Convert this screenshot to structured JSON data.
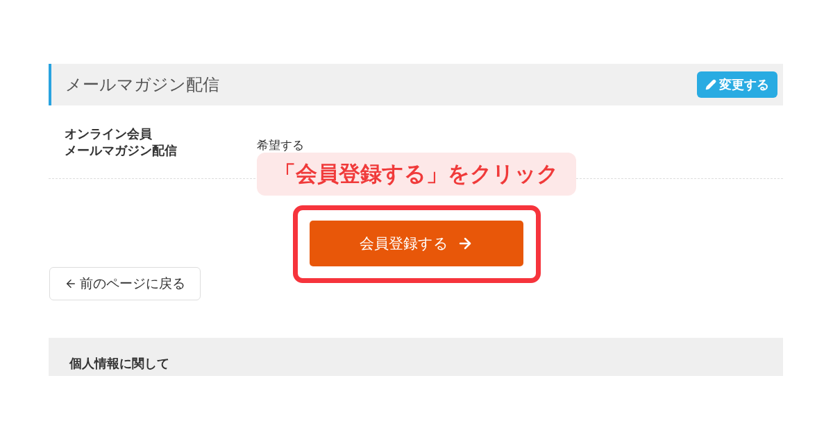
{
  "section": {
    "title": "メールマガジン配信",
    "edit_button": "変更する"
  },
  "rows": [
    {
      "label": [
        "オンライン会員",
        "メールマガジン配信"
      ],
      "value": "希望する"
    }
  ],
  "callout": "「会員登録する」をクリック",
  "register_button": {
    "label": "会員登録する",
    "highlighted": true
  },
  "back_button": "前のページに戻る",
  "privacy": {
    "title": "個人情報に関して"
  }
}
